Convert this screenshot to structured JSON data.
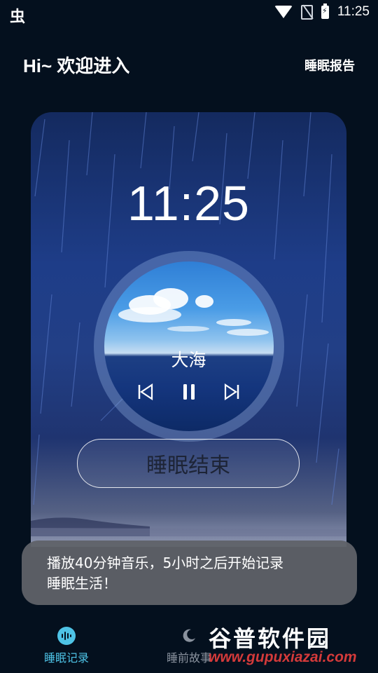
{
  "status_bar": {
    "app_icon": "虫",
    "time": "11:25",
    "icons": [
      "wifi-icon",
      "no-sim-icon",
      "battery-charging-icon"
    ]
  },
  "header": {
    "greeting": "Hi~ 欢迎进入",
    "report_link": "睡眠报告"
  },
  "player": {
    "clock": "11:25",
    "track_name": "大海",
    "controls": [
      "previous-icon",
      "pause-icon",
      "next-icon"
    ],
    "end_button": "睡眠结束"
  },
  "toast": {
    "text_line1": "播放40分钟音乐，5小时之后开始记录",
    "text_line2": "睡眠生活！"
  },
  "bottom_nav": {
    "items": [
      {
        "label": "睡眠记录",
        "icon": "audio-wave-icon",
        "active": true
      },
      {
        "label": "睡前故事",
        "icon": "moon-icon",
        "active": false
      }
    ]
  },
  "watermark": {
    "text": "谷普软件园",
    "url": "www.gupuxiazai.com"
  },
  "colors": {
    "background": "#04101e",
    "accent": "#4ec3e6",
    "inactive": "#8a929e"
  }
}
